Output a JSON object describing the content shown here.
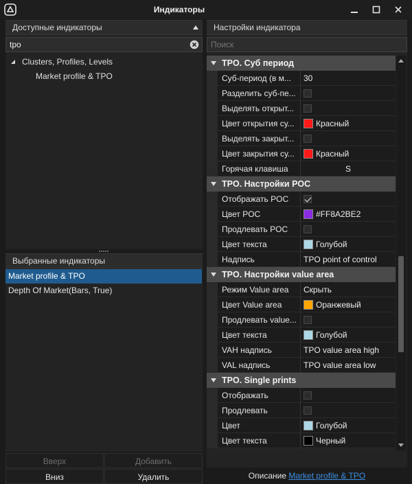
{
  "window": {
    "title": "Индикаторы"
  },
  "available": {
    "header": "Доступные индикаторы",
    "search_value": "tpo",
    "tree": [
      {
        "label": "Clusters, Profiles, Levels"
      },
      {
        "label": "Market profile & TPO"
      }
    ]
  },
  "selected": {
    "header": "Выбранные индикаторы",
    "items": [
      {
        "label": "Market profile & TPO",
        "selected": true
      },
      {
        "label": "Depth Of Market(Bars, True)",
        "selected": false
      }
    ]
  },
  "buttons": {
    "up": "Вверх",
    "add": "Добавить",
    "down": "Вниз",
    "delete": "Удалить"
  },
  "settings": {
    "header": "Настройки индикатора",
    "search_placeholder": "Поиск",
    "categories": [
      {
        "title": "TPO. Суб период",
        "rows": [
          {
            "name": "Суб-период (в м...",
            "type": "text",
            "value": "30"
          },
          {
            "name": "Разделить суб-пе...",
            "type": "checkbox",
            "checked": false
          },
          {
            "name": "Выделять открыт...",
            "type": "checkbox",
            "checked": false
          },
          {
            "name": "Цвет открытия су...",
            "type": "color",
            "color": "#FF1A1A",
            "value": "Красный"
          },
          {
            "name": "Выделять закрыт...",
            "type": "checkbox",
            "checked": false
          },
          {
            "name": "Цвет закрытия су...",
            "type": "color",
            "color": "#FF1A1A",
            "value": "Красный"
          },
          {
            "name": "Горячая клавиша",
            "type": "hotkey",
            "value": "S"
          }
        ]
      },
      {
        "title": "TPO. Настройки POC",
        "rows": [
          {
            "name": "Отображать POC",
            "type": "checkbox",
            "checked": true
          },
          {
            "name": "Цвет POC",
            "type": "color",
            "color": "#8A2BE2",
            "value": "#FF8A2BE2"
          },
          {
            "name": "Продлевать POC",
            "type": "checkbox",
            "checked": false
          },
          {
            "name": "Цвет текста",
            "type": "color",
            "color": "#ADD8E6",
            "value": "Голубой"
          },
          {
            "name": "Надпись",
            "type": "text",
            "value": "TPO point of control"
          }
        ]
      },
      {
        "title": "TPO. Настройки value area",
        "rows": [
          {
            "name": "Режим Value area",
            "type": "text",
            "value": "Скрыть"
          },
          {
            "name": "Цвет Value area",
            "type": "color",
            "color": "#FFA500",
            "value": "Оранжевый"
          },
          {
            "name": "Продлевать value...",
            "type": "checkbox",
            "checked": false
          },
          {
            "name": "Цвет текста",
            "type": "color",
            "color": "#ADD8E6",
            "value": "Голубой"
          },
          {
            "name": "VAH надпись",
            "type": "text",
            "value": "TPO value area high"
          },
          {
            "name": "VAL надпись",
            "type": "text",
            "value": "TPO value area low"
          }
        ]
      },
      {
        "title": "TPO. Single prints",
        "rows": [
          {
            "name": "Отображать",
            "type": "checkbox",
            "checked": false
          },
          {
            "name": "Продлевать",
            "type": "checkbox",
            "checked": false
          },
          {
            "name": "Цвет",
            "type": "color",
            "color": "#ADD8E6",
            "value": "Голубой"
          },
          {
            "name": "Цвет текста",
            "type": "color",
            "color": "#000000",
            "value": "Черный"
          }
        ]
      }
    ]
  },
  "description": {
    "label": "Описание",
    "link": "Market profile & TPO"
  }
}
